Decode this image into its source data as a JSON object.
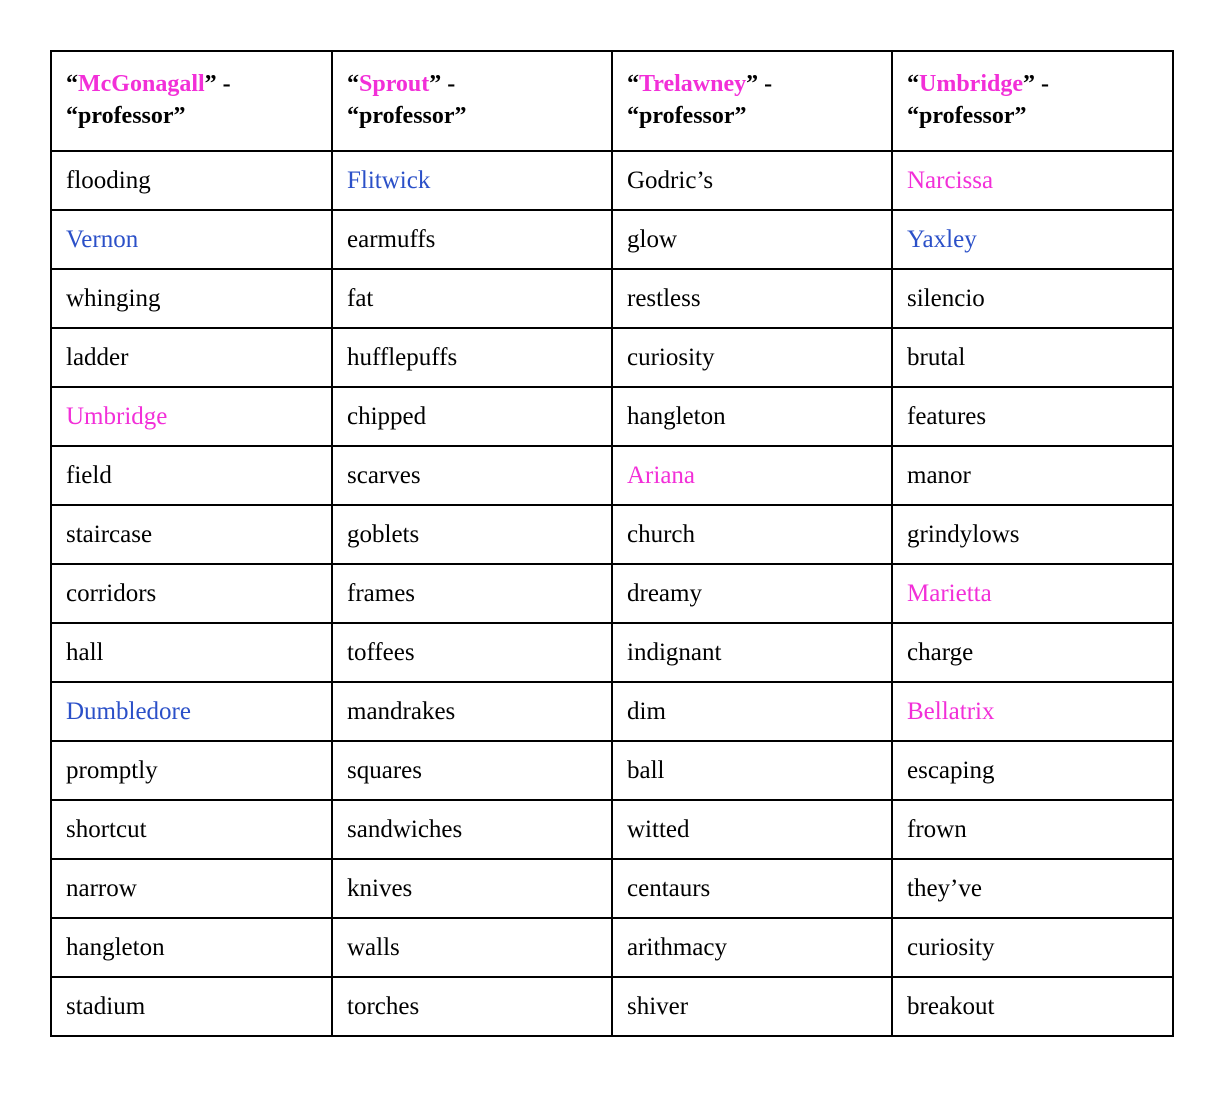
{
  "table": {
    "colors": {
      "highlight_pink": "#f22fd8",
      "highlight_blue": "#2b50c8",
      "text_default": "#000000",
      "border": "#000000",
      "background": "#ffffff"
    },
    "headers": [
      {
        "quote_open": "“",
        "name": "McGonagall",
        "quote_close": "”",
        "dash": " - ",
        "second": "“professor”"
      },
      {
        "quote_open": "“",
        "name": "Sprout",
        "quote_close": "”",
        "dash": " - ",
        "second": "“professor”"
      },
      {
        "quote_open": "“",
        "name": "Trelawney",
        "quote_close": "”",
        "dash": " - ",
        "second": "“professor”"
      },
      {
        "quote_open": "“",
        "name": "Umbridge",
        "quote_close": "”",
        "dash": " - ",
        "second": "“professor”"
      }
    ],
    "rows": [
      [
        {
          "text": "flooding",
          "style": "plain"
        },
        {
          "text": "Flitwick",
          "style": "blue"
        },
        {
          "text": "Godric’s",
          "style": "plain"
        },
        {
          "text": "Narcissa",
          "style": "pink"
        }
      ],
      [
        {
          "text": "Vernon",
          "style": "blue"
        },
        {
          "text": "earmuffs",
          "style": "plain"
        },
        {
          "text": "glow",
          "style": "plain"
        },
        {
          "text": "Yaxley",
          "style": "blue"
        }
      ],
      [
        {
          "text": "whinging",
          "style": "plain"
        },
        {
          "text": "fat",
          "style": "plain"
        },
        {
          "text": "restless",
          "style": "plain"
        },
        {
          "text": "silencio",
          "style": "plain"
        }
      ],
      [
        {
          "text": "ladder",
          "style": "plain"
        },
        {
          "text": "hufflepuffs",
          "style": "plain"
        },
        {
          "text": "curiosity",
          "style": "plain"
        },
        {
          "text": "brutal",
          "style": "plain"
        }
      ],
      [
        {
          "text": "Umbridge",
          "style": "pink"
        },
        {
          "text": "chipped",
          "style": "plain"
        },
        {
          "text": "hangleton",
          "style": "plain"
        },
        {
          "text": "features",
          "style": "plain"
        }
      ],
      [
        {
          "text": "field",
          "style": "plain"
        },
        {
          "text": "scarves",
          "style": "plain"
        },
        {
          "text": "Ariana",
          "style": "pink"
        },
        {
          "text": "manor",
          "style": "plain"
        }
      ],
      [
        {
          "text": "staircase",
          "style": "plain"
        },
        {
          "text": "goblets",
          "style": "plain"
        },
        {
          "text": "church",
          "style": "plain"
        },
        {
          "text": "grindylows",
          "style": "plain"
        }
      ],
      [
        {
          "text": "corridors",
          "style": "plain"
        },
        {
          "text": "frames",
          "style": "plain"
        },
        {
          "text": "dreamy",
          "style": "plain"
        },
        {
          "text": "Marietta",
          "style": "pink"
        }
      ],
      [
        {
          "text": "hall",
          "style": "plain"
        },
        {
          "text": "toffees",
          "style": "plain"
        },
        {
          "text": "indignant",
          "style": "plain"
        },
        {
          "text": "charge",
          "style": "plain"
        }
      ],
      [
        {
          "text": "Dumbledore",
          "style": "blue"
        },
        {
          "text": "mandrakes",
          "style": "plain"
        },
        {
          "text": "dim",
          "style": "plain"
        },
        {
          "text": "Bellatrix",
          "style": "pink"
        }
      ],
      [
        {
          "text": "promptly",
          "style": "plain"
        },
        {
          "text": "squares",
          "style": "plain"
        },
        {
          "text": "ball",
          "style": "plain"
        },
        {
          "text": "escaping",
          "style": "plain"
        }
      ],
      [
        {
          "text": "shortcut",
          "style": "plain"
        },
        {
          "text": "sandwiches",
          "style": "plain"
        },
        {
          "text": "witted",
          "style": "plain"
        },
        {
          "text": "frown",
          "style": "plain"
        }
      ],
      [
        {
          "text": "narrow",
          "style": "plain"
        },
        {
          "text": "knives",
          "style": "plain"
        },
        {
          "text": "centaurs",
          "style": "plain"
        },
        {
          "text": "they’ve",
          "style": "plain"
        }
      ],
      [
        {
          "text": "hangleton",
          "style": "plain"
        },
        {
          "text": "walls",
          "style": "plain"
        },
        {
          "text": "arithmacy",
          "style": "plain"
        },
        {
          "text": "curiosity",
          "style": "plain"
        }
      ],
      [
        {
          "text": "stadium",
          "style": "plain"
        },
        {
          "text": "torches",
          "style": "plain"
        },
        {
          "text": "shiver",
          "style": "plain"
        },
        {
          "text": "breakout",
          "style": "plain"
        }
      ]
    ]
  }
}
